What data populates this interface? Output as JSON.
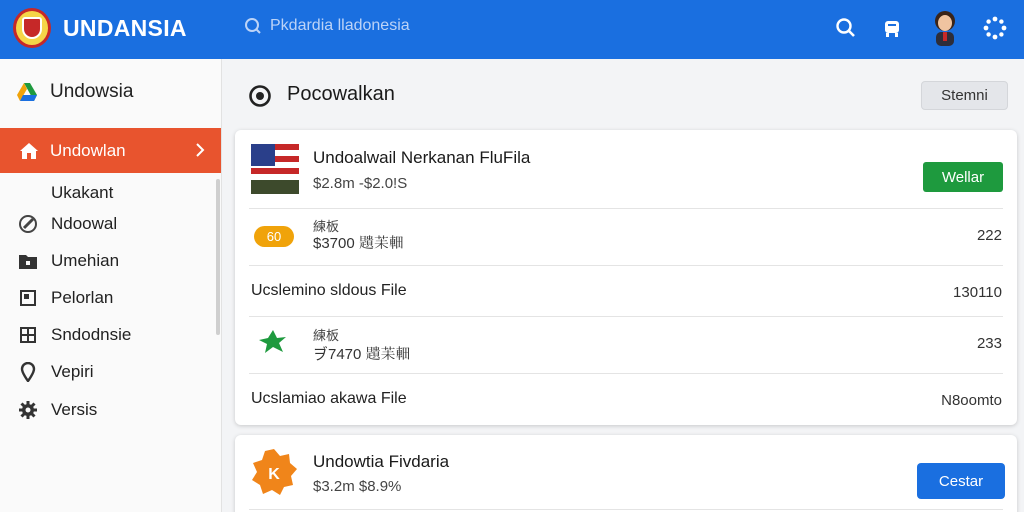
{
  "header": {
    "app_title": "UNDANSIA",
    "search_placeholder": "Pkdardia lladonesia"
  },
  "sidebar": {
    "heading": "Undowsia",
    "active_item": "Undowlan",
    "items": [
      {
        "label": "Ukakant",
        "icon": "none"
      },
      {
        "label": "Ndoowal",
        "icon": "edit-icon"
      },
      {
        "label": "Umehian",
        "icon": "folder-icon"
      },
      {
        "label": "Pelorlan",
        "icon": "document-icon"
      },
      {
        "label": "Sndodnsie",
        "icon": "grid-icon"
      },
      {
        "label": "Vepiri",
        "icon": "location-icon"
      },
      {
        "label": "Versis",
        "icon": "gear-icon"
      }
    ]
  },
  "main": {
    "title": "Pocowalkan",
    "top_button": "Stemni"
  },
  "card1": {
    "row1": {
      "title": "Undoalwail Nerkanan FluFila",
      "subtitle": "$2.8m -$2.0!S",
      "button": "Wellar"
    },
    "row2": {
      "badge": "60",
      "caption": "練板",
      "value": "$3700 𧸯苿䡒",
      "number": "222"
    },
    "row3": {
      "text": "Ucslemino sldous File",
      "number": "130110"
    },
    "row4": {
      "caption": "練板",
      "value": "ヺ7470 𧸯苿䡒",
      "number": "233"
    },
    "row5": {
      "text": "Ucslamiao akawa File",
      "number": "N8oomto"
    }
  },
  "card2": {
    "title": "Undowtia Fivdaria",
    "subtitle": "$3.2m  $8.9%",
    "button": "Cestar"
  },
  "colors": {
    "topbar": "#1a6fe0",
    "active": "#e8542e",
    "green_button": "#1e9a3e",
    "badge": "#f0a30a"
  }
}
